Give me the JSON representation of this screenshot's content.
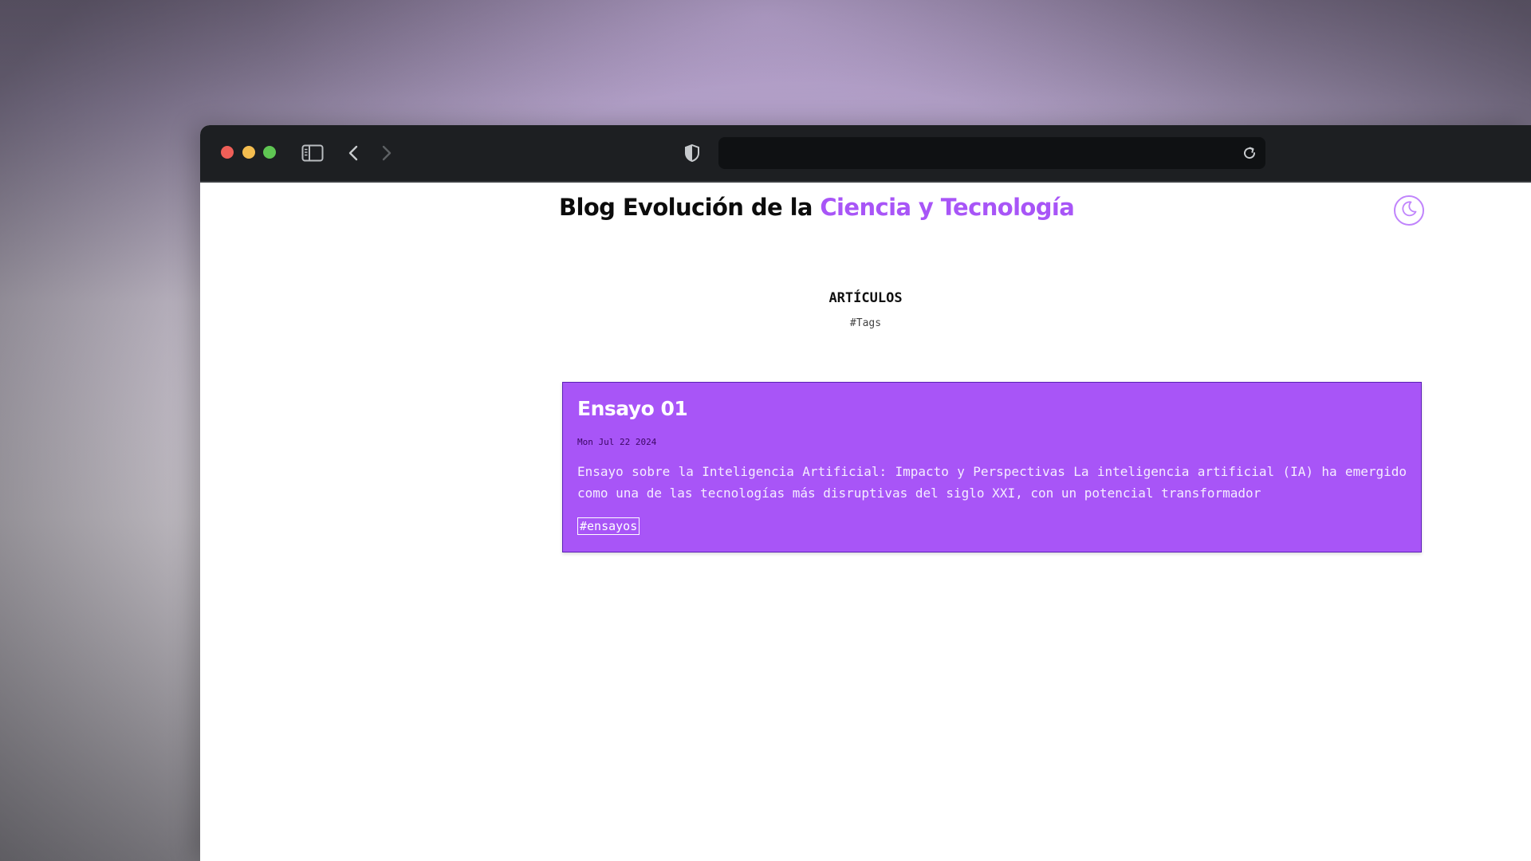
{
  "browser": {
    "url": "",
    "traffic_lights": {
      "close": "#ef5f58",
      "minimize": "#f4bd4f",
      "maximize": "#5fc653"
    },
    "icons": {
      "sidebar": "sidebar-toggle-icon",
      "back": "chevron-left-icon",
      "forward": "chevron-right-icon",
      "privacy": "shield-icon",
      "reload": "reload-icon"
    }
  },
  "header": {
    "title_plain": "Blog Evolución de la ",
    "title_accent": "Ciencia y Tecnología",
    "accent_color": "#a855f7",
    "theme_toggle_icon": "moon-icon"
  },
  "main": {
    "heading": "ARTÍCULOS",
    "tags_link": "#Tags",
    "articles": [
      {
        "title": "Ensayo 01",
        "date": "Mon Jul 22 2024",
        "excerpt": "Ensayo sobre la Inteligencia Artificial: Impacto y Perspectivas La inteligencia artificial (IA) ha emergido como una de las tecnologías más disruptivas del siglo XXI, con un potencial transformador",
        "tag": "#ensayos",
        "card_color": "#a855f7"
      }
    ]
  }
}
